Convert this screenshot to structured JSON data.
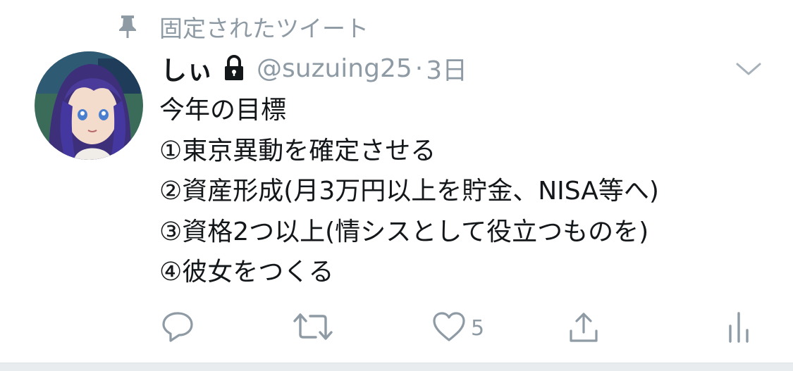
{
  "pinned": {
    "label": "固定されたツイート",
    "icon": "pin-icon"
  },
  "tweet": {
    "display_name": "しぃ",
    "protected_icon": "lock-icon",
    "handle": "@suzuing25",
    "separator": "·",
    "time": "3日",
    "lines": [
      "今年の目標",
      "①東京異動を確定させる",
      "②資産形成(月3万円以上を貯金、NISA等へ)",
      "③資格2つ以上(情シスとして役立つものを)",
      "④彼女をつくる"
    ]
  },
  "actions": {
    "reply_icon": "reply-icon",
    "retweet_icon": "retweet-icon",
    "like_icon": "heart-icon",
    "like_count": "5",
    "share_icon": "share-icon",
    "analytics_icon": "analytics-icon"
  },
  "colors": {
    "text": "#14171a",
    "muted": "#8e9aa4",
    "background": "#ffffff"
  }
}
